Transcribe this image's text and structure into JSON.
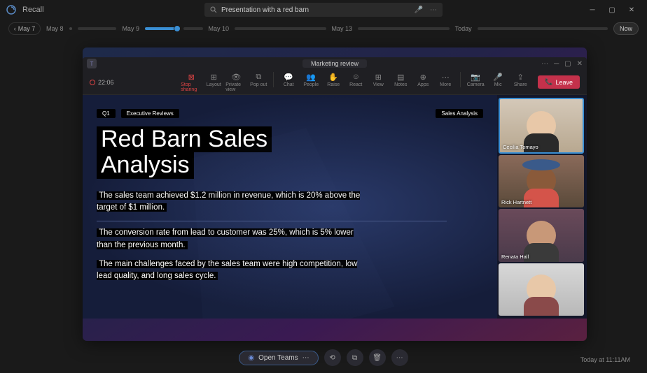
{
  "app": {
    "name": "Recall"
  },
  "search": {
    "placeholder": "",
    "value": "Presentation with a red barn"
  },
  "timeline": {
    "back_label": "May 7",
    "days": [
      "May 8",
      "May 9",
      "May 10",
      "May 13",
      "Today"
    ],
    "now_label": "Now"
  },
  "teams": {
    "title": "Marketing review",
    "rec_time": "22:06",
    "tools": {
      "stop": "Stop sharing",
      "layout": "Layout",
      "private": "Private view",
      "popout": "Pop out",
      "chat": "Chat",
      "people": "People",
      "raise": "Raise",
      "react": "React",
      "view": "View",
      "notes": "Notes",
      "apps": "Apps",
      "more": "More",
      "camera": "Camera",
      "mic": "Mic",
      "share": "Share"
    },
    "leave_label": "Leave",
    "participants": [
      {
        "name": "Cecilia Tomayo"
      },
      {
        "name": "Rick Hartnett"
      },
      {
        "name": "Renata Hall"
      },
      {
        "name": ""
      }
    ]
  },
  "slide": {
    "tag_q": "Q1",
    "tag_section": "Executive Reviews",
    "tag_right": "Sales Analysis",
    "title_line1": "Red Barn Sales",
    "title_line2": "Analysis",
    "para1": "The sales team achieved $1.2 million in revenue, which is 20% above the target of $1 million.",
    "para2": "The conversion rate from lead to customer was 25%, which is 5% lower than the previous month.",
    "para3": "The main challenges faced by the sales team were high competition, low lead quality, and long sales cycle."
  },
  "footer": {
    "open_label": "Open Teams",
    "timestamp": "Today at 11:11AM"
  }
}
